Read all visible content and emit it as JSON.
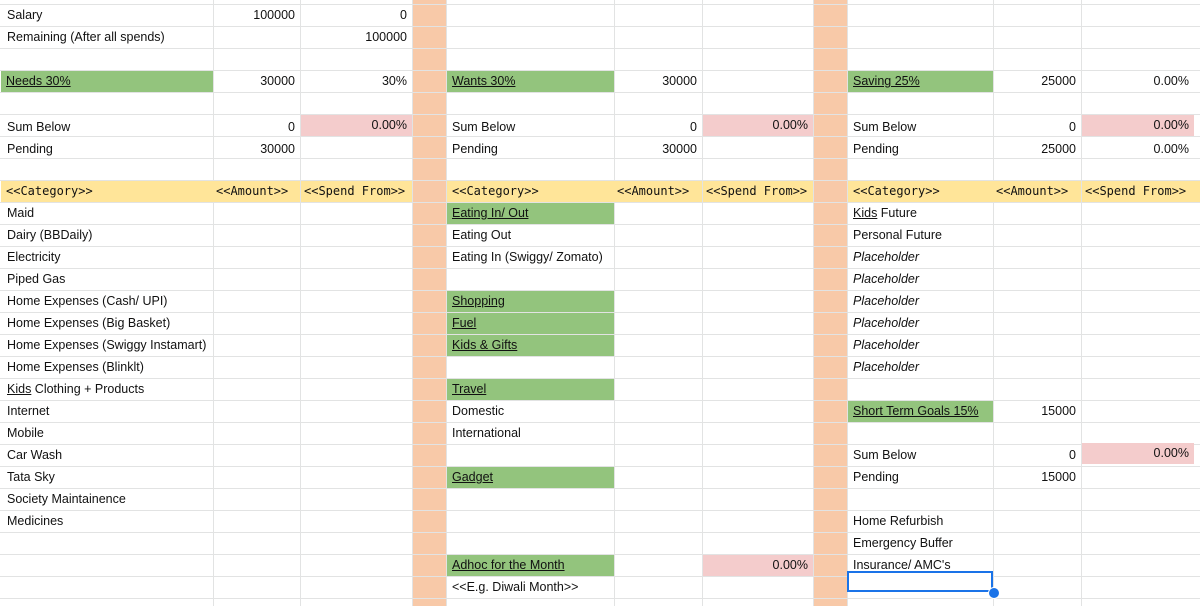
{
  "summary": {
    "salary_label": "Salary",
    "salary_value": "100000",
    "salary_value2": "0",
    "remaining_label": "Remaining (After all spends)",
    "remaining_value": "100000"
  },
  "needs": {
    "title": "Needs 30%",
    "amount": "30000",
    "pct": "30%",
    "sum_label": "Sum Below",
    "sum_value": "0",
    "sum_pct": "0.00%",
    "pending_label": "Pending",
    "pending_value": "30000",
    "headers": [
      "<<Category>>",
      "<<Amount>>",
      "<<Spend From>>"
    ],
    "items": [
      "Maid",
      "Dairy (BBDaily)",
      "Electricity",
      "Piped Gas",
      "Home Expenses (Cash/ UPI)",
      "Home Expenses (Big Basket)",
      "Home Expenses (Swiggy Instamart)",
      "Home Expenses (Blinklt)",
      "Kids",
      "Internet",
      "Mobile",
      "Car Wash",
      "Tata Sky",
      "Society Maintainence",
      "Medicines"
    ],
    "kids_suffix": " Clothing + Products"
  },
  "wants": {
    "title": "Wants 30%",
    "amount": "30000",
    "sum_label": "Sum Below",
    "sum_value": "0",
    "sum_pct": "0.00%",
    "pending_label": "Pending",
    "pending_value": "30000",
    "headers": [
      "<<Category>>",
      "<<Amount>>",
      "<<Spend From>>"
    ],
    "eating_group": "Eating In/ Out",
    "eating_out": "Eating Out",
    "eating_in": "Eating In (Swiggy/ Zomato)",
    "shopping": "Shopping",
    "fuel": "Fuel",
    "kids_gifts": "Kids & Gifts",
    "travel": "Travel",
    "domestic": "Domestic",
    "international": "International",
    "gadget": "Gadget",
    "adhoc": "Adhoc for the Month",
    "adhoc_pct": "0.00%",
    "adhoc_example": "<<E.g. Diwali Month>>"
  },
  "saving": {
    "title": "Saving 25%",
    "amount": "25000",
    "pct": "0.00%",
    "sum_label": "Sum Below",
    "sum_value": "0",
    "sum_pct": "0.00%",
    "pending_label": "Pending",
    "pending_value": "25000",
    "pending_pct": "0.00%",
    "headers": [
      "<<Category>>",
      "<<Amount>>",
      "<<Spend From>>"
    ],
    "kids_bold": "Kids",
    "kids_suffix": " Future",
    "personal_future": "Personal Future",
    "placeholder": "Placeholder",
    "stg_title": "Short Term Goals 15%",
    "stg_amount": "15000",
    "stg_sum_label": "Sum Below",
    "stg_sum_value": "0",
    "stg_sum_pct": "0.00%",
    "stg_pending_label": "Pending",
    "stg_pending_value": "15000",
    "stg_items": [
      "Home Refurbish",
      "Emergency Buffer",
      "Insurance/ AMC's"
    ]
  },
  "colors": {
    "green": "#93c47d",
    "yellow": "#ffe599",
    "pink": "#f4cccc",
    "separator": "#f8c9a8",
    "selection": "#1a73e8"
  }
}
